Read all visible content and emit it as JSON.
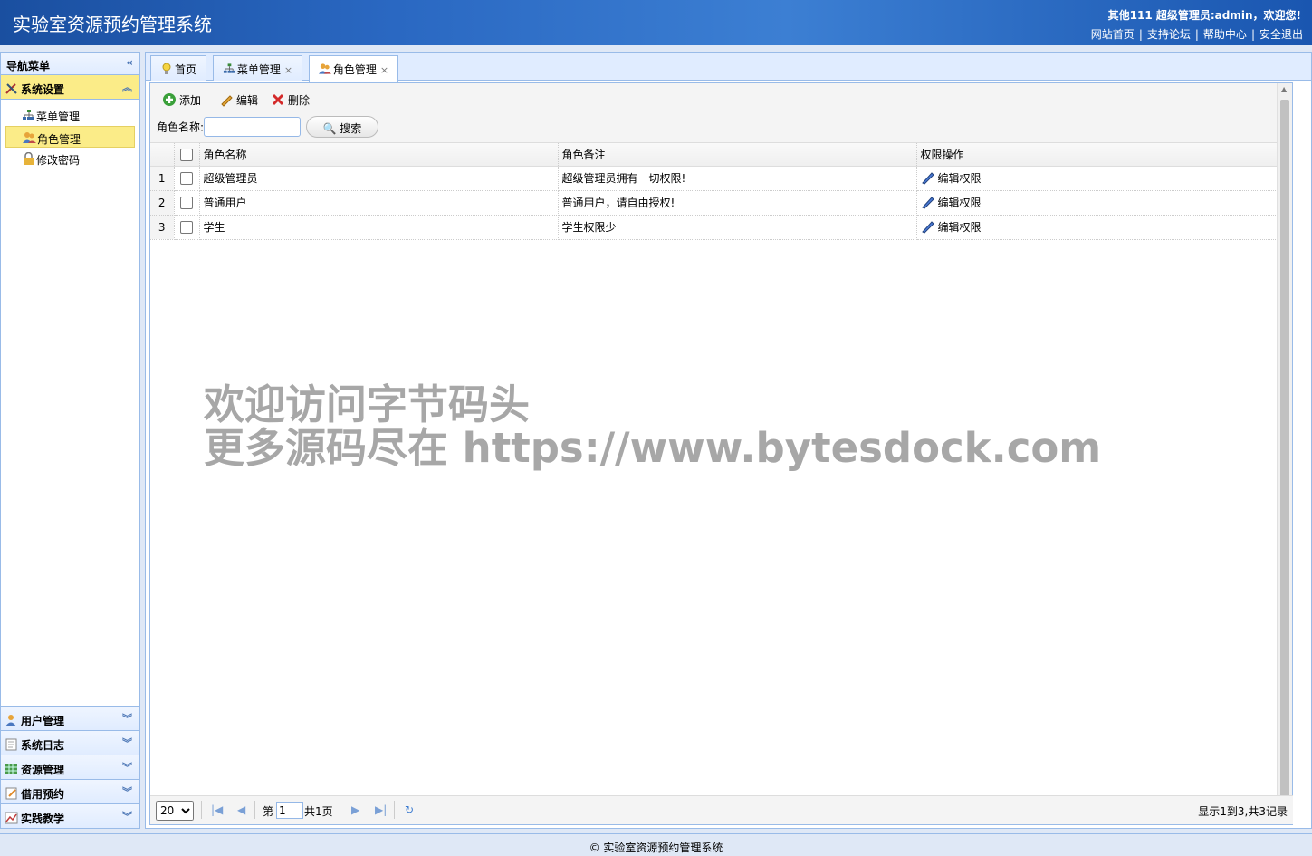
{
  "header": {
    "title": "实验室资源预约管理系统",
    "welcome": "其他111 超级管理员:admin，欢迎您!",
    "links": [
      "网站首页",
      "支持论坛",
      "帮助中心",
      "安全退出"
    ]
  },
  "sidebar": {
    "title": "导航菜单",
    "active_group": {
      "label": "系统设置",
      "items": [
        {
          "label": "菜单管理",
          "icon": "sitemap-icon"
        },
        {
          "label": "角色管理",
          "icon": "users-icon",
          "selected": true
        },
        {
          "label": "修改密码",
          "icon": "lock-icon"
        }
      ]
    },
    "groups": [
      "用户管理",
      "系统日志",
      "资源管理",
      "借用预约",
      "实践教学"
    ]
  },
  "tabs": [
    {
      "label": "首页",
      "closable": false
    },
    {
      "label": "菜单管理",
      "closable": true
    },
    {
      "label": "角色管理",
      "closable": true,
      "active": true
    }
  ],
  "toolbar": {
    "add_label": "添加",
    "edit_label": "编辑",
    "delete_label": "删除",
    "search_label": "角色名称:",
    "search_value": "",
    "search_button": "搜索"
  },
  "grid": {
    "columns": [
      "角色名称",
      "角色备注",
      "权限操作"
    ],
    "rows": [
      {
        "num": "1",
        "name": "超级管理员",
        "remark": "超级管理员拥有一切权限!",
        "action": "编辑权限"
      },
      {
        "num": "2",
        "name": "普通用户",
        "remark": "普通用户，请自由授权!",
        "action": "编辑权限"
      },
      {
        "num": "3",
        "name": "学生",
        "remark": "学生权限少",
        "action": "编辑权限"
      }
    ]
  },
  "pager": {
    "page_size": "20",
    "page_prefix": "第",
    "page_value": "1",
    "page_suffix": "共1页",
    "info": "显示1到3,共3记录"
  },
  "watermark": {
    "line1": "欢迎访问字节码头",
    "line2": "更多源码尽在  https://www.bytesdock.com"
  },
  "footer": "© 实验室资源预约管理系统",
  "colors": {
    "header_bg": "#2a68c2",
    "border": "#99bbe8",
    "selected": "#fbec88",
    "panel_bg": "#e0ecff"
  }
}
